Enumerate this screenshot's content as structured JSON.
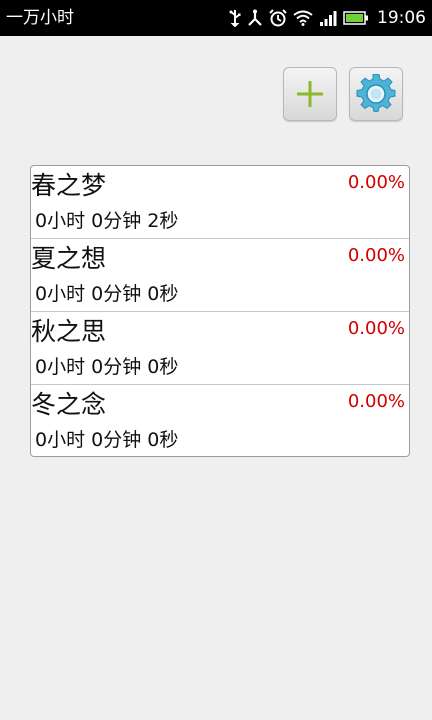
{
  "status_bar": {
    "app_title": "一万小时",
    "time": "19:06",
    "icons": [
      "usb-icon",
      "share-icon",
      "alarm-icon",
      "wifi-icon",
      "signal-icon",
      "battery-icon"
    ]
  },
  "toolbar": {
    "add_icon": "plus-icon",
    "settings_icon": "gear-icon",
    "accent_color": "#8ab92d",
    "gear_color": "#4db4d8"
  },
  "timers": [
    {
      "name": "春之梦",
      "percent": "0.00%",
      "duration": "0小时 0分钟 2秒"
    },
    {
      "name": "夏之想",
      "percent": "0.00%",
      "duration": "0小时 0分钟 0秒"
    },
    {
      "name": "秋之思",
      "percent": "0.00%",
      "duration": "0小时 0分钟 0秒"
    },
    {
      "name": "冬之念",
      "percent": "0.00%",
      "duration": "0小时 0分钟 0秒"
    }
  ],
  "colors": {
    "percent": "#d10000",
    "background": "#efefef"
  }
}
